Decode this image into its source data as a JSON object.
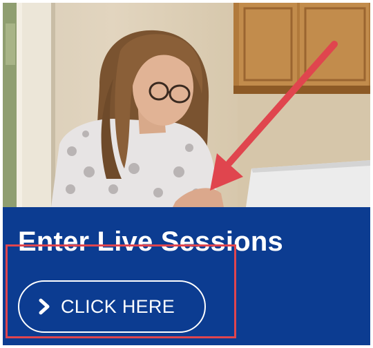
{
  "card": {
    "title": "Enter Live Sessions",
    "cta_label": "CLICK HERE",
    "cta_icon": "chevron-right-icon"
  },
  "colors": {
    "panel_background": "#0c3c91",
    "annotation_red": "#e0454e",
    "text": "#ffffff"
  },
  "annotations": {
    "arrow": "red-arrow-pointing-down-left",
    "highlight": "red-rectangle-around-button"
  }
}
